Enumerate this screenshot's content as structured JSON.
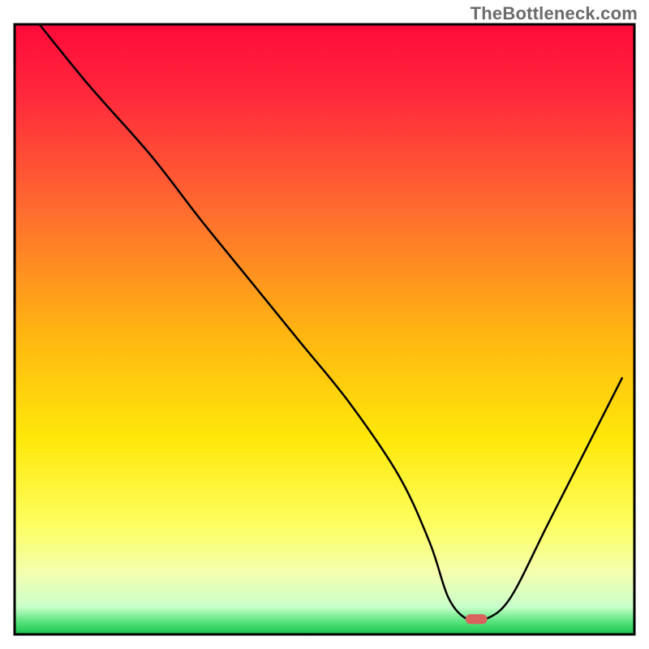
{
  "watermark": "TheBottleneck.com",
  "chart_data": {
    "type": "line",
    "title": "",
    "xlabel": "",
    "ylabel": "",
    "xlim": [
      0,
      100
    ],
    "ylim": [
      0,
      100
    ],
    "grid": false,
    "legend": false,
    "annotations": [],
    "axis_visible": false,
    "background_gradient_stops": [
      {
        "pos": 0.0,
        "color": "#ff0a3a"
      },
      {
        "pos": 0.12,
        "color": "#ff2a3c"
      },
      {
        "pos": 0.3,
        "color": "#ff6a30"
      },
      {
        "pos": 0.5,
        "color": "#ffb312"
      },
      {
        "pos": 0.68,
        "color": "#ffe80a"
      },
      {
        "pos": 0.82,
        "color": "#fdff60"
      },
      {
        "pos": 0.9,
        "color": "#f4ffb0"
      },
      {
        "pos": 0.955,
        "color": "#c9ffcb"
      },
      {
        "pos": 0.98,
        "color": "#54e27a"
      },
      {
        "pos": 1.0,
        "color": "#18c24c"
      }
    ],
    "series": [
      {
        "name": "bottleneck-curve",
        "x": [
          4,
          12,
          22,
          30,
          38,
          46,
          54,
          62,
          67,
          70,
          73,
          76,
          80,
          86,
          92,
          98
        ],
        "y": [
          100,
          90,
          78.5,
          68,
          58,
          48,
          38,
          26,
          15,
          6,
          2.5,
          2.5,
          6,
          18,
          30,
          42
        ]
      }
    ],
    "marker": {
      "name": "optimal-point",
      "x": 74.5,
      "y": 2.5,
      "width_pct": 3.5,
      "height_pct": 1.6,
      "color": "#d9625d"
    },
    "frame": {
      "stroke": "#000000",
      "stroke_width": 3
    }
  }
}
